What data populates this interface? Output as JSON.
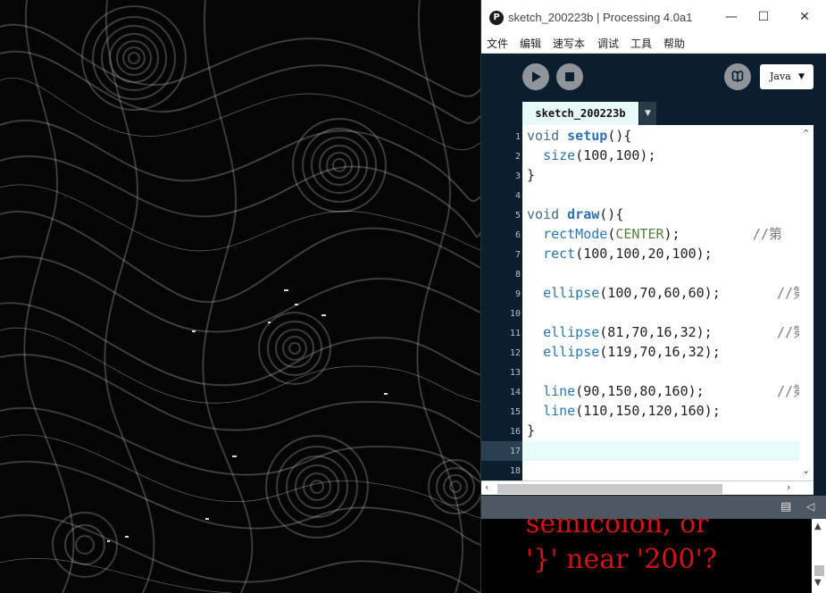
{
  "window": {
    "title": "sketch_200223b | Processing 4.0a1"
  },
  "menu": {
    "items": [
      "文件",
      "编辑",
      "速写本",
      "调试",
      "工具",
      "帮助"
    ]
  },
  "toolbar": {
    "mode": "Java"
  },
  "tabs": {
    "active": "sketch_200223b"
  },
  "editor": {
    "line_numbers": [
      "1",
      "2",
      "3",
      "4",
      "5",
      "6",
      "7",
      "8",
      "9",
      "10",
      "11",
      "12",
      "13",
      "14",
      "15",
      "16",
      "17",
      "18"
    ],
    "current_line": "17"
  },
  "console": {
    "lines": [
      "semicolon, or",
      "'}' near '200'?"
    ]
  },
  "colors": {
    "error_text": "#d11313",
    "editor_bg": "#0b1e2d",
    "current_line": "#e7fbfb"
  }
}
